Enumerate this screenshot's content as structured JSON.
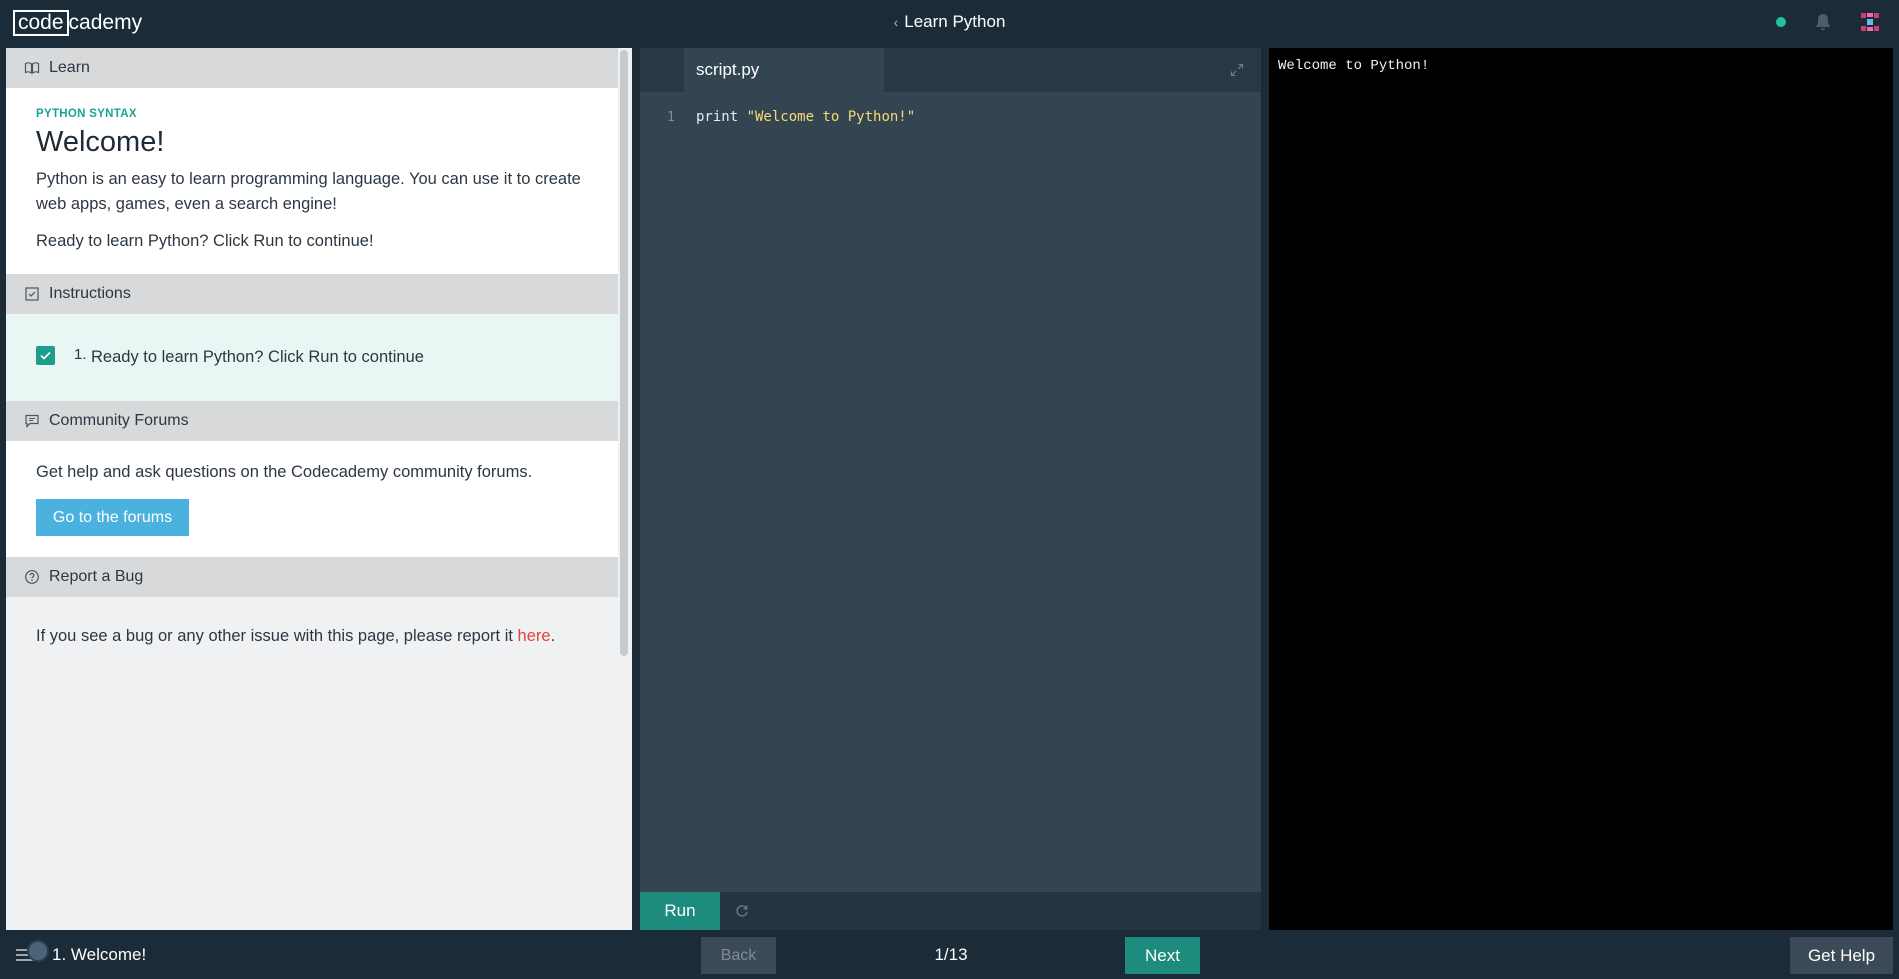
{
  "header": {
    "logo_left": "code",
    "logo_right": "cademy",
    "back_chevron": "‹",
    "course_title": "Learn Python",
    "status_color": "#1fc2a0"
  },
  "lesson": {
    "learn_heading": "Learn",
    "kicker": "PYTHON SYNTAX",
    "title": "Welcome!",
    "paragraph1": "Python is an easy to learn programming language. You can use it to create web apps, games, even a search engine!",
    "paragraph2": "Ready to learn Python? Click Run to continue!",
    "instructions_heading": "Instructions",
    "instruction_number": "1.",
    "instruction_text": "Ready to learn Python? Click Run to continue",
    "forums_heading": "Community Forums",
    "forums_text": "Get help and ask questions on the Codecademy community forums.",
    "forums_button": "Go to the forums",
    "bug_heading": "Report a Bug",
    "bug_text": "If you see a bug or any other issue with this page, please report it ",
    "bug_link": "here",
    "bug_period": "."
  },
  "editor": {
    "tab_name": "script.py",
    "line_number": "1",
    "code_keyword": "print ",
    "code_string": "\"Welcome to Python!\"",
    "run_label": "Run"
  },
  "output": {
    "text": "Welcome to Python!"
  },
  "footer": {
    "lesson_name": "1. Welcome!",
    "back_label": "Back",
    "progress": "1/13",
    "next_label": "Next",
    "help_label": "Get Help"
  },
  "icons": {
    "learn": "book-icon",
    "instructions": "checkbox-icon",
    "forums": "chat-icon",
    "bug": "question-circle-icon",
    "expand": "expand-icon",
    "reset": "refresh-icon",
    "menu": "menu-icon",
    "bell": "bell-icon"
  },
  "colors": {
    "teal": "#1d8b7d",
    "forum_button": "#4bb2e0",
    "link_red": "#e5433a",
    "dark_bg": "#1b2b38"
  }
}
